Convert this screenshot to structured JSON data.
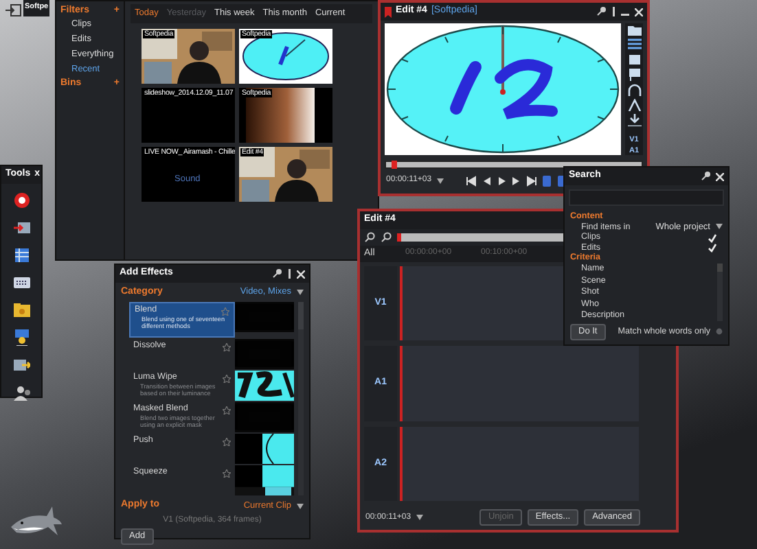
{
  "topbar": {
    "tab": "Softpe"
  },
  "browser": {
    "filters": {
      "title": "Filters",
      "add": "+",
      "items": [
        {
          "label": "Clips",
          "selected": false
        },
        {
          "label": "Edits",
          "selected": false
        },
        {
          "label": "Everything",
          "selected": false
        },
        {
          "label": "Recent",
          "selected": true
        }
      ]
    },
    "bins": {
      "title": "Bins",
      "add": "+"
    },
    "tabs": [
      {
        "label": "Today",
        "selected": true,
        "disabled": false
      },
      {
        "label": "Yesterday",
        "selected": false,
        "disabled": true
      },
      {
        "label": "This week",
        "selected": false,
        "disabled": false
      },
      {
        "label": "This month",
        "selected": false,
        "disabled": false
      },
      {
        "label": "Current",
        "selected": false,
        "disabled": false
      }
    ],
    "clips": [
      {
        "label": "Softpedia",
        "kind": "person"
      },
      {
        "label": "Softpedia",
        "kind": "clock"
      },
      {
        "label": "slideshow_2014.12.09_11.07",
        "kind": "blank"
      },
      {
        "label": "Softpedia",
        "kind": "gradient"
      },
      {
        "label": "LIVE NOW_ Airamash - Chille",
        "kind": "audio",
        "sub": "Sound"
      },
      {
        "label": "Edit #4",
        "kind": "person"
      }
    ]
  },
  "tools": {
    "title": "Tools",
    "close": "x"
  },
  "viewer": {
    "title": "Edit #4",
    "subtitle": "[Softpedia]",
    "tracks": [
      "V1",
      "A1"
    ],
    "level": 0.02,
    "timecode": "00:00:11+03"
  },
  "search": {
    "title": "Search",
    "content": {
      "title": "Content",
      "find_label": "Find items in",
      "find_value": "Whole project",
      "options": [
        {
          "label": "Clips",
          "checked": true
        },
        {
          "label": "Edits",
          "checked": true
        }
      ]
    },
    "criteria": {
      "title": "Criteria",
      "items": [
        "Name",
        "Scene",
        "Shot",
        "Who",
        "Description"
      ]
    },
    "button": "Do It",
    "match": {
      "label": "Match whole words only",
      "on": false
    }
  },
  "timeline": {
    "title": "Edit #4",
    "level": 0,
    "ruler_label": "All",
    "ruler": [
      "00:00:00+00",
      "00:10:00+00"
    ],
    "tracks": [
      "V1",
      "A1",
      "A2"
    ],
    "timecode": "00:00:11+03",
    "buttons": [
      {
        "label": "Unjoin",
        "disabled": true
      },
      {
        "label": "Effects...",
        "disabled": false
      },
      {
        "label": "Advanced",
        "disabled": false
      }
    ]
  },
  "effects": {
    "title": "Add Effects",
    "category_label": "Category",
    "category_value": "Video, Mixes",
    "items": [
      {
        "name": "Blend",
        "description": "Blend using one of seventeen different methods",
        "selected": true,
        "kind": "black"
      },
      {
        "name": "Dissolve",
        "selected": false,
        "kind": "black"
      },
      {
        "name": "Luma Wipe",
        "description": "Transition between images based on their luminance",
        "selected": false,
        "kind": "luma"
      },
      {
        "name": "Masked Blend",
        "description": "Blend two images together using an explicit mask",
        "selected": false,
        "kind": "black"
      },
      {
        "name": "Push",
        "selected": false,
        "kind": "push"
      },
      {
        "name": "Squeeze",
        "selected": false,
        "kind": "squeeze"
      }
    ],
    "apply_label": "Apply to",
    "apply_value": "Current Clip",
    "info": "V1 (Softpedia, 364 frames)",
    "button": "Add"
  }
}
